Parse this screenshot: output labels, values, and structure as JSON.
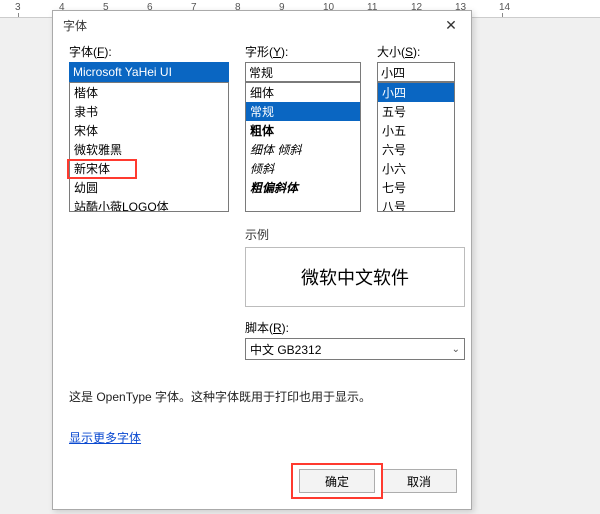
{
  "ruler": {
    "marks": [
      3,
      4,
      5,
      6,
      7,
      8,
      9,
      10,
      11,
      12,
      13,
      14
    ]
  },
  "dialog": {
    "title": "字体",
    "close": "✕",
    "font": {
      "label_pre": "字体(",
      "label_key": "F",
      "label_post": "):",
      "value": "Microsoft YaHei UI",
      "items": [
        "楷体",
        "隶书",
        "宋体",
        "微软雅黑",
        "新宋体",
        "幼圆",
        "站酷小薇LOGO体"
      ]
    },
    "style": {
      "label_pre": "字形(",
      "label_key": "Y",
      "label_post": "):",
      "value": "常规",
      "items": [
        {
          "text": "细体",
          "bold": false,
          "italic": false,
          "sel": false
        },
        {
          "text": "常规",
          "bold": false,
          "italic": false,
          "sel": true
        },
        {
          "text": "粗体",
          "bold": true,
          "italic": false,
          "sel": false
        },
        {
          "text": "细体 倾斜",
          "bold": false,
          "italic": true,
          "sel": false
        },
        {
          "text": "倾斜",
          "bold": false,
          "italic": true,
          "sel": false
        },
        {
          "text": "粗偏斜体",
          "bold": true,
          "italic": true,
          "sel": false
        }
      ]
    },
    "size": {
      "label_pre": "大小(",
      "label_key": "S",
      "label_post": "):",
      "value": "小四",
      "items": [
        "小四",
        "五号",
        "小五",
        "六号",
        "小六",
        "七号",
        "八号"
      ]
    },
    "sample": {
      "label": "示例",
      "text": "微软中文软件"
    },
    "script": {
      "label_pre": "脚本(",
      "label_key": "R",
      "label_post": "):",
      "value": "中文 GB2312"
    },
    "info": "这是 OpenType 字体。这种字体既用于打印也用于显示。",
    "link": "显示更多字体",
    "ok": "确定",
    "cancel": "取消"
  }
}
